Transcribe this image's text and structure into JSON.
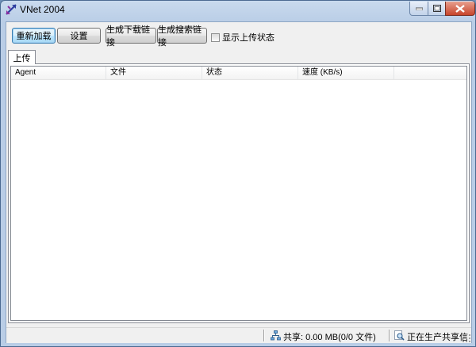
{
  "window": {
    "title": "VNet 2004"
  },
  "toolbar": {
    "reload_label": "重新加载",
    "settings_label": "设置",
    "gen_download_link_label": "生成下载链接",
    "gen_search_link_label": "生成搜索链接",
    "show_upload_status_label": "显示上传状态",
    "show_upload_status_checked": false
  },
  "tabs": [
    {
      "label": "上传",
      "selected": true
    }
  ],
  "upload_list": {
    "columns": [
      "Agent",
      "文件",
      "状态",
      "速度 (KB/s)",
      ""
    ],
    "rows": []
  },
  "statusbar": {
    "share_text": "共享: 0.00 MB(0/0 文件)",
    "status_text": "正在生产共享信"
  },
  "icons": {
    "app": "vnet-logo-icon",
    "share": "network-share-icon",
    "status": "search-magnifier-icon"
  }
}
